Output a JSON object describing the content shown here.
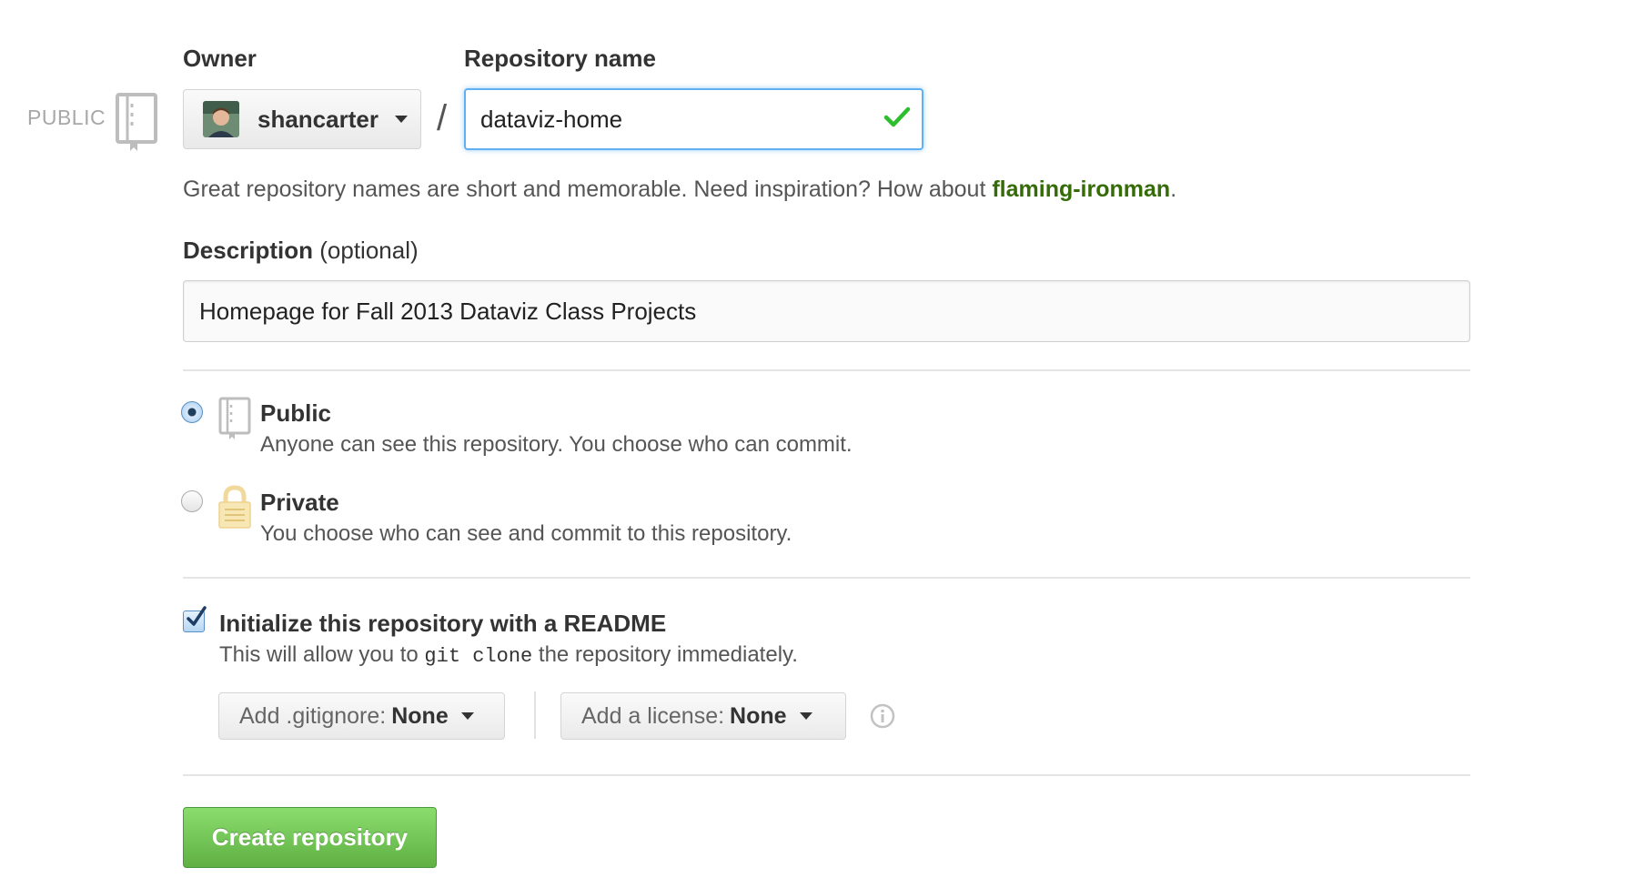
{
  "visibility_tag": "PUBLIC",
  "owner": {
    "label": "Owner",
    "name": "shancarter"
  },
  "repo": {
    "label": "Repository name",
    "separator": "/",
    "value": "dataviz-home"
  },
  "hint": {
    "text": "Great repository names are short and memorable. Need inspiration? How about ",
    "suggestion": "flaming-ironman",
    "end": "."
  },
  "description": {
    "label": "Description",
    "label_suffix": " (optional)",
    "value": "Homepage for Fall 2013 Dataviz Class Projects"
  },
  "visibility": {
    "selected": "public",
    "public": {
      "title": "Public",
      "desc": "Anyone can see this repository. You choose who can commit."
    },
    "private": {
      "title": "Private",
      "desc": "You choose who can see and commit to this repository."
    }
  },
  "readme": {
    "checked": true,
    "title": "Initialize this repository with a README",
    "desc_before": "This will allow you to ",
    "desc_code": "git clone",
    "desc_after": " the repository immediately."
  },
  "gitignore": {
    "label": "Add .gitignore:",
    "value": "None"
  },
  "license": {
    "label": "Add a license:",
    "value": "None"
  },
  "create_button": "Create repository",
  "colors": {
    "accent_green": "#60b044",
    "focus_blue": "#5fb0f4",
    "suggestion_green": "#356c07"
  }
}
